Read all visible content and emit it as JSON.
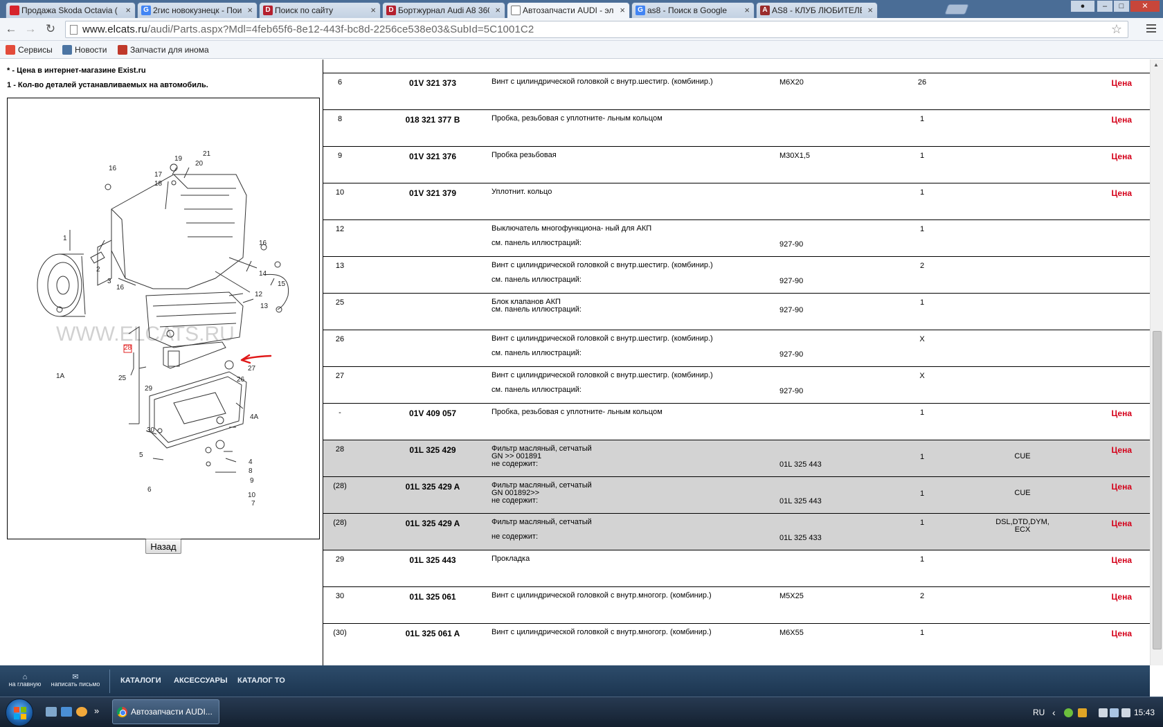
{
  "browser": {
    "tabs": [
      {
        "label": "Продажа Skoda Octavia (",
        "icon_color": "#d6232b",
        "icon_text": "",
        "active": false
      },
      {
        "label": "2гис новокузнецк - Поис",
        "icon_color": "#4285f4",
        "icon_text": "G",
        "active": false
      },
      {
        "label": "Поиск по сайту",
        "icon_color": "#b5202e",
        "icon_text": "D",
        "active": false
      },
      {
        "label": "Бортжурнал Audi A8 360",
        "icon_color": "#b5202e",
        "icon_text": "D",
        "active": false
      },
      {
        "label": "Автозапчасти AUDI - эле",
        "icon_color": "#ffffff",
        "icon_text": "",
        "active": true
      },
      {
        "label": "as8 - Поиск в Google",
        "icon_color": "#4285f4",
        "icon_text": "G",
        "active": false
      },
      {
        "label": "AS8 - КЛУБ ЛЮБИТЕЛЕЙ",
        "icon_color": "#9a2b2b",
        "icon_text": "A",
        "active": false
      }
    ],
    "close_glyph": "×",
    "url_host": "www.elcats.ru",
    "url_path": "/audi/Parts.aspx?Mdl=4feb65f6-8e12-443f-bc8d-2256ce538e03&SubId=5C1001C2",
    "bookmarks": [
      {
        "label": "Сервисы",
        "icon": "apps-grid-icon",
        "color": "#e34b3a"
      },
      {
        "label": "Новости",
        "icon": "vk-icon",
        "color": "#4c75a3"
      },
      {
        "label": "Запчасти для инома",
        "icon": "exist-icon",
        "color": "#c0392b"
      }
    ]
  },
  "left": {
    "legend_1_prefix": "* ",
    "legend_1_text": "- Цена в интернет-магазине Exist.ru",
    "legend_2_prefix": "1 ",
    "legend_2_text": "- Кол-во деталей устанавливаемых на автомобиль.",
    "watermark": "WWW.ELCATS.RU",
    "callouts": [
      "1",
      "1A",
      "2",
      "3",
      "4",
      "4A",
      "5",
      "6",
      "7",
      "8",
      "9",
      "10",
      "12",
      "13",
      "14",
      "15",
      "16",
      "16",
      "16",
      "17",
      "18",
      "19",
      "20",
      "21",
      "25",
      "26",
      "27",
      "28",
      "29",
      "30"
    ],
    "back_label": "Назад"
  },
  "parts": [
    {
      "pos": "6",
      "num": "01V 321 373",
      "name": "Винт с цилиндрической головкой с внутр.шестигр. (комбинир.)",
      "sub": "",
      "note": "M6X20",
      "note2": "",
      "qty": "26",
      "code": "",
      "price": "Цена",
      "hl": false
    },
    {
      "pos": "8",
      "num": "018 321 377 B",
      "name": "Пробка, резьбовая с уплотните- льным кольцом",
      "sub": "",
      "note": "",
      "note2": "",
      "qty": "1",
      "code": "",
      "price": "Цена",
      "hl": false
    },
    {
      "pos": "9",
      "num": "01V 321 376",
      "name": "Пробка резьбовая",
      "sub": "",
      "note": "M30X1,5",
      "note2": "",
      "qty": "1",
      "code": "",
      "price": "Цена",
      "hl": false
    },
    {
      "pos": "10",
      "num": "01V 321 379",
      "name": "Уплотнит. кольцо",
      "sub": "",
      "note": "",
      "note2": "",
      "qty": "1",
      "code": "",
      "price": "Цена",
      "hl": false
    },
    {
      "pos": "12",
      "num": "",
      "name": "Выключатель многофункциона- ный для АКП",
      "sub": "см. панель иллюстраций:",
      "note": "",
      "note2": "927-90",
      "qty": "1",
      "code": "",
      "price": "",
      "hl": false
    },
    {
      "pos": "13",
      "num": "",
      "name": "Винт с цилиндрической головкой с внутр.шестигр. (комбинир.)",
      "sub": "см. панель иллюстраций:",
      "note": "",
      "note2": "927-90",
      "qty": "2",
      "code": "",
      "price": "",
      "hl": false
    },
    {
      "pos": "25",
      "num": "",
      "name": "Блок клапанов АКП",
      "sub": "см. панель иллюстраций:",
      "note": "",
      "note2": "927-90",
      "qty": "1",
      "code": "",
      "price": "",
      "hl": false,
      "tight": true
    },
    {
      "pos": "26",
      "num": "",
      "name": "Винт с цилиндрической головкой с внутр.шестигр. (комбинир.)",
      "sub": "см. панель иллюстраций:",
      "note": "",
      "note2": "927-90",
      "qty": "X",
      "code": "",
      "price": "",
      "hl": false
    },
    {
      "pos": "27",
      "num": "",
      "name": "Винт с цилиндрической головкой с внутр.шестигр. (комбинир.)",
      "sub": "см. панель иллюстраций:",
      "note": "",
      "note2": "927-90",
      "qty": "X",
      "code": "",
      "price": "",
      "hl": false
    },
    {
      "pos": "-",
      "num": "01V 409 057",
      "name": "Пробка, резьбовая с уплотните- льным кольцом",
      "sub": "",
      "note": "",
      "note2": "",
      "qty": "1",
      "code": "",
      "price": "Цена",
      "hl": false
    },
    {
      "pos": "28",
      "num": "01L 325 429",
      "name": "Фильтр масляный, сетчатый",
      "sub": "GN >> 001891",
      "sub2": "не содержит:",
      "note": "",
      "note2": "01L 325 443",
      "qty": "1",
      "code": "CUE",
      "price": "Цена",
      "hl": true
    },
    {
      "pos": "(28)",
      "num": "01L 325 429 A",
      "name": "Фильтр масляный, сетчатый",
      "sub": "GN 001892>>",
      "sub2": "не содержит:",
      "note": "",
      "note2": "01L 325 443",
      "qty": "1",
      "code": "CUE",
      "price": "Цена",
      "hl": true
    },
    {
      "pos": "(28)",
      "num": "01L 325 429 A",
      "name": "Фильтр масляный, сетчатый",
      "sub": "не содержит:",
      "note": "",
      "note2": "01L 325 433",
      "qty": "1",
      "code": "DSL,DTD,DYM, ECX",
      "price": "Цена",
      "hl": true
    },
    {
      "pos": "29",
      "num": "01L 325 443",
      "name": "Прокладка",
      "sub": "",
      "note": "",
      "note2": "",
      "qty": "1",
      "code": "",
      "price": "Цена",
      "hl": false
    },
    {
      "pos": "30",
      "num": "01L 325 061",
      "name": "Винт с цилиндрической головкой с внутр.многогр. (комбинир.)",
      "sub": "",
      "note": "M5X25",
      "note2": "",
      "qty": "2",
      "code": "",
      "price": "Цена",
      "hl": false
    },
    {
      "pos": "(30)",
      "num": "01L 325 061 A",
      "name": "Винт с цилиндрической головкой с внутр.многогр. (комбинир.)",
      "sub": "",
      "note": "M6X55",
      "note2": "",
      "qty": "1",
      "code": "",
      "price": "Цена",
      "hl": false
    }
  ],
  "footer": {
    "home_label": "на главную",
    "mail_label": "написать письмо",
    "links": [
      "КАТАЛОГИ",
      "АКСЕССУАРЫ",
      "КАТАЛОГ ТО"
    ]
  },
  "taskbar": {
    "task_label": "Автозапчасти AUDI...",
    "lang": "RU",
    "time": "15:43",
    "more_glyph": "»",
    "tray_arrow": "‹"
  },
  "colors": {
    "price_red": "#d4001a",
    "highlight_row": "#d3d3d3",
    "footer_bg": "#1c3550"
  }
}
